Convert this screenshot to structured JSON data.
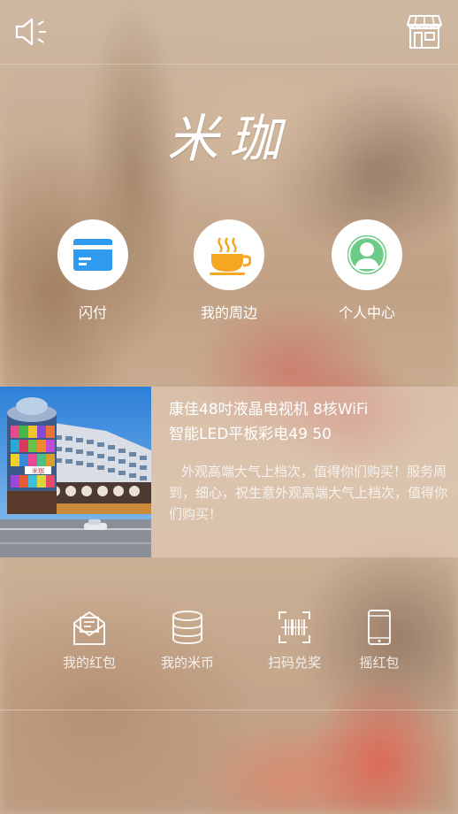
{
  "header": {
    "sound_icon": "speaker-icon",
    "store_icon": "storefront-icon"
  },
  "logo": {
    "text": "米珈"
  },
  "main_actions": [
    {
      "label": "闪付",
      "icon": "card-icon",
      "color": "#2f9bf0"
    },
    {
      "label": "我的周边",
      "icon": "coffee-cup-icon",
      "color": "#f5a623"
    },
    {
      "label": "个人中心",
      "icon": "user-icon",
      "color": "#6ccb86"
    }
  ],
  "promo": {
    "title_line1": "康佳48吋液晶电视机 8核WiFi",
    "title_line2": "智能LED平板彩电49 50",
    "description": "外观高端大气上档次，值得你们购买！服务周到，细心，祝生意外观高端大气上档次，值得你们购买！",
    "building_sign": "米珈"
  },
  "bottom_actions": [
    {
      "label": "我的红包",
      "icon": "red-envelope-icon"
    },
    {
      "label": "我的米币",
      "icon": "coin-stack-icon"
    },
    {
      "label": "扫码兑奖",
      "icon": "barcode-scan-icon"
    },
    {
      "label": "摇红包",
      "icon": "phone-shake-icon"
    }
  ]
}
